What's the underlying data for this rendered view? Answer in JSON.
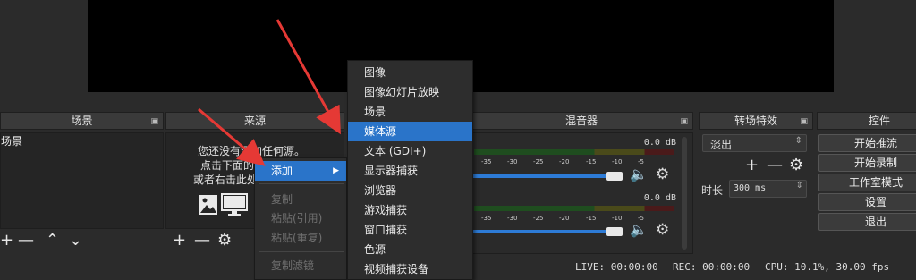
{
  "docks": {
    "scenes": {
      "title": "场景",
      "item": "场景"
    },
    "sources": {
      "title": "来源",
      "empty_line1": "您还没有添加任何源。",
      "empty_line2": "点击下面的",
      "empty_line3": "或者右击此处"
    },
    "mixer": {
      "title": "混音器",
      "track1_db": "0.0 dB",
      "track2_db": "0.0 dB",
      "ticks": [
        "-35",
        "-30",
        "-25",
        "-20",
        "-15",
        "-10",
        "-5",
        "0"
      ]
    },
    "transitions": {
      "title": "转场特效",
      "selected": "淡出",
      "duration_label": "时长",
      "duration_value": "300 ms"
    },
    "controls": {
      "title": "控件",
      "buttons": [
        "开始推流",
        "开始录制",
        "工作室模式",
        "设置",
        "退出"
      ]
    }
  },
  "context_menu": {
    "add": "添加",
    "copy": "复制",
    "paste_ref": "粘贴(引用)",
    "paste_dup": "粘贴(重复)",
    "copy_filter": "复制滤镜"
  },
  "submenu": {
    "items": [
      "图像",
      "图像幻灯片放映",
      "场景",
      "媒体源",
      "文本 (GDI+)",
      "显示器捕获",
      "浏览器",
      "游戏捕获",
      "窗口捕获",
      "色源",
      "视频捕获设备"
    ],
    "highlighted_index": 3
  },
  "status_bar": {
    "live": "LIVE: 00:00:00",
    "rec": "REC: 00:00:00",
    "cpu": "CPU: 10.1%, 30.00 fps"
  },
  "colors": {
    "accent": "#2a74c9",
    "arrow": "#e53935"
  },
  "icons": [
    "image-icon",
    "monitor-icon",
    "gear-icon",
    "speaker-icon",
    "plus-icon",
    "minus-icon",
    "up-icon",
    "down-icon",
    "float-icon",
    "submenu-arrow-icon"
  ]
}
